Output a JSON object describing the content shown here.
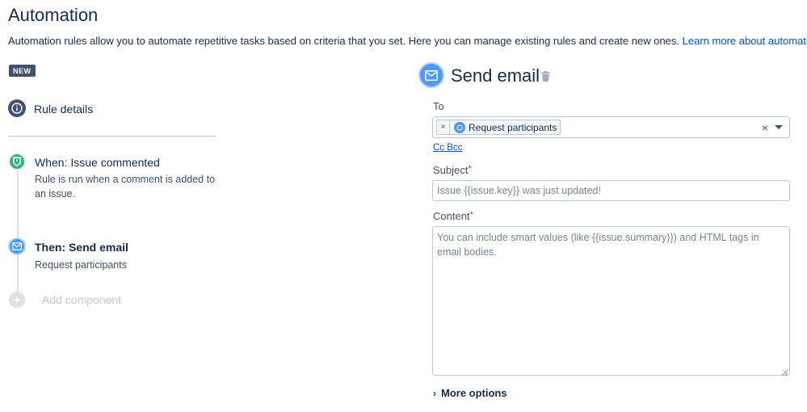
{
  "header": {
    "title": "Automation",
    "description": "Automation rules allow you to automate repetitive tasks based on criteria that you set. Here you can manage existing rules and create new ones.",
    "learn_more": "Learn more about automation"
  },
  "badge": "NEW",
  "rule": {
    "details_label": "Rule details",
    "when_title": "When: Issue commented",
    "when_sub": "Rule is run when a comment is added to an issue.",
    "then_title": "Then: Send email",
    "then_sub": "Request participants",
    "add_component": "Add component"
  },
  "panel": {
    "title": "Send email",
    "to_label": "To",
    "to_chip": "Request participants",
    "cc_bcc": "Cc Bcc",
    "subject_label": "Subject",
    "subject_placeholder": "Issue {{issue.key}} was just updated!",
    "content_label": "Content",
    "content_placeholder": "You can include smart values (like {{issue.summary}}) and HTML tags in email bodies.",
    "more_options": "More options"
  },
  "icons": {
    "rule_details": "info-icon",
    "when": "trigger-icon",
    "then": "email-icon",
    "add": "plus-icon",
    "delete": "trash-icon"
  },
  "colors": {
    "link": "#0052cc",
    "trigger": "#36b37e",
    "action": "#4c9aff",
    "required": "#de350b"
  }
}
